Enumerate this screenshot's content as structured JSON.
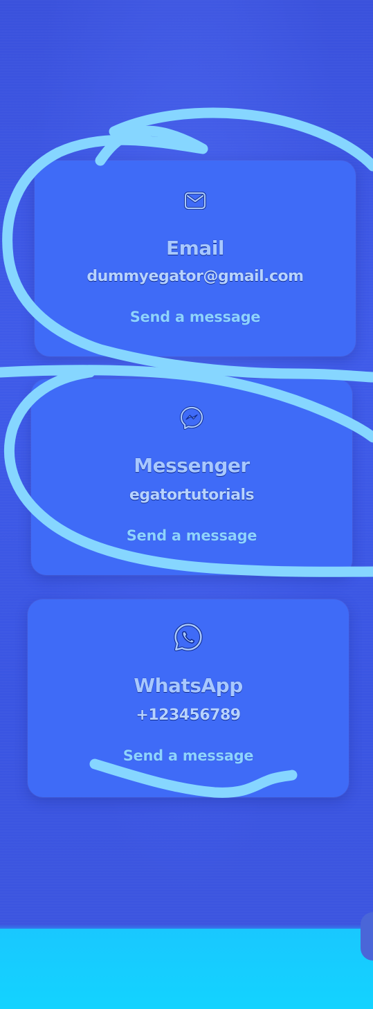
{
  "contacts": [
    {
      "icon": "mail-icon",
      "title": "Email",
      "value": "dummyegator@gmail.com",
      "link_label": "Send a message"
    },
    {
      "icon": "messenger-icon",
      "title": "Messenger",
      "value": "egatortutorials",
      "link_label": "Send a message"
    },
    {
      "icon": "whatsapp-icon",
      "title": "WhatsApp",
      "value": "+123456789",
      "link_label": "Send a message"
    }
  ],
  "colors": {
    "background": "#3a51dc",
    "card": "#3f6bf7",
    "title_text": "#a8c8ff",
    "link_text": "#8ed3ff",
    "annotation_stroke": "#86d6ff",
    "bottom_bar": "#19c8ff"
  }
}
